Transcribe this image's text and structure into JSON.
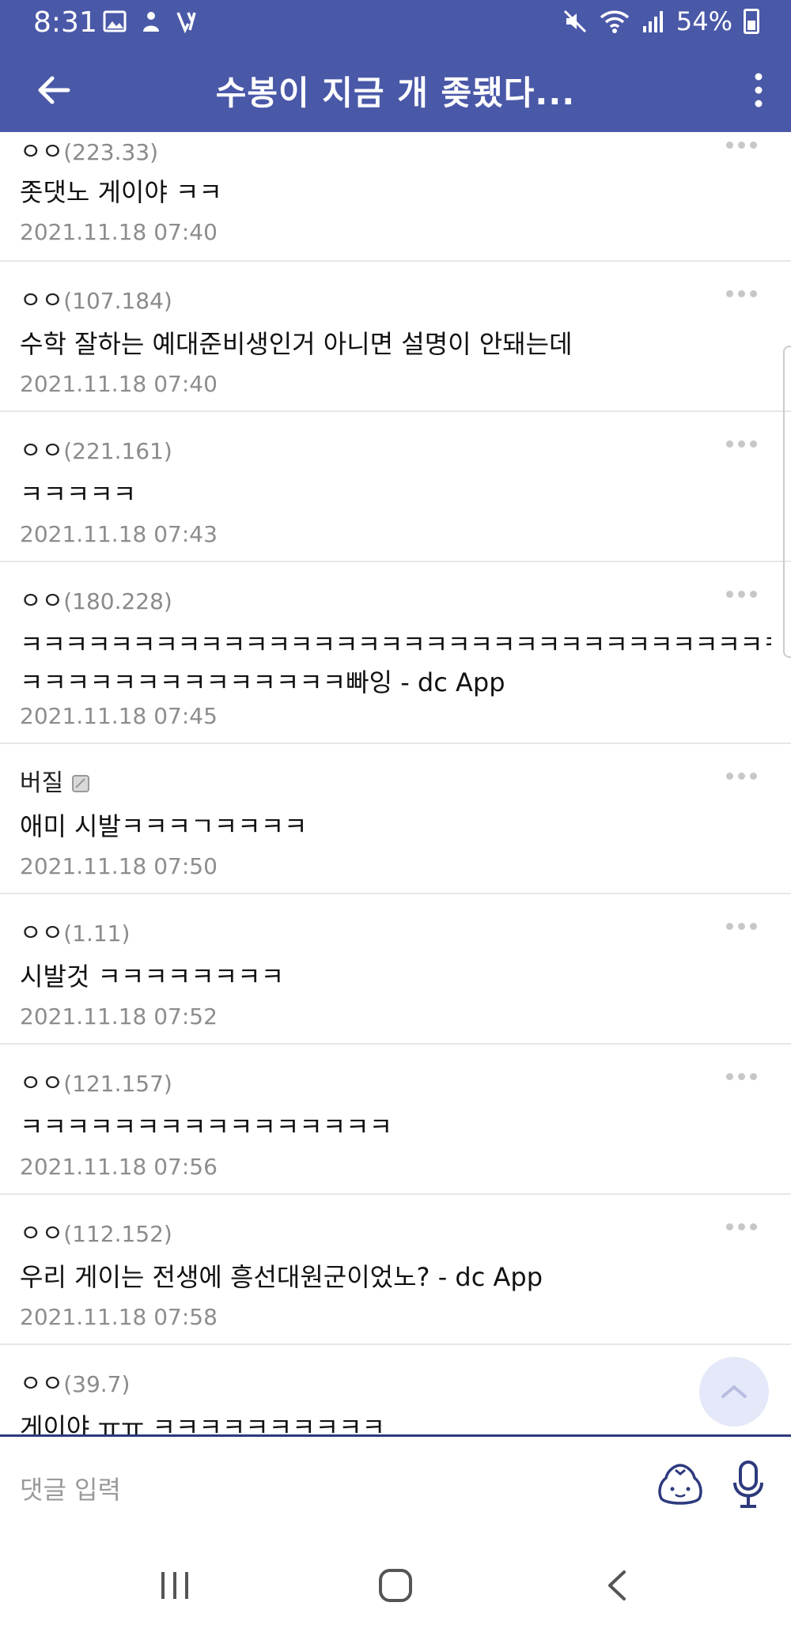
{
  "status_bar": {
    "time": "8:31",
    "battery": "54%",
    "left_icons": [
      "image-icon",
      "tutoring-icon",
      "v-app-icon"
    ],
    "right_icons": [
      "mute-icon",
      "wifi-icon",
      "signal-icon",
      "battery-icon"
    ]
  },
  "app_bar": {
    "title": "수봉이 지금 개 좆됐다...",
    "color": "#4a58a8"
  },
  "comments": [
    {
      "author": "ㅇㅇ",
      "ip": "(223.33)",
      "lines": [
        "좃댓노 게이야 ㅋㅋ"
      ],
      "date": "2021.11.18 07:40"
    },
    {
      "author": "ㅇㅇ",
      "ip": "(107.184)",
      "lines": [
        "수학 잘하는 예대준비생인거 아니면 설명이 안돼는데"
      ],
      "date": "2021.11.18 07:40"
    },
    {
      "author": "ㅇㅇ",
      "ip": "(221.161)",
      "lines": [
        "ㅋㅋㅋㅋㅋ"
      ],
      "date": "2021.11.18 07:43"
    },
    {
      "author": "ㅇㅇ",
      "ip": "(180.228)",
      "lines": [
        "ㅋㅋㅋㅋㅋㅋㅋㅋㅋㅋㅋㅋㅋㅋㅋㅋㅋㅋㅋㅋㅋㅋㅋㅋㅋㅋㅋㅋㅋㅋㅋㅋㅋㅋㅋ",
        "ㅋㅋㅋㅋㅋㅋㅋㅋㅋㅋㅋㅋㅋㅋ빠잉 - dc App"
      ],
      "date": "2021.11.18 07:45"
    },
    {
      "author": "버질",
      "ip": "",
      "lines": [
        "애미 시발ㅋㅋㅋㄱㅋㅋㅋㅋ"
      ],
      "date": "2021.11.18 07:50"
    },
    {
      "author": "ㅇㅇ",
      "ip": "(1.11)",
      "lines": [
        "시발것 ㅋㅋㅋㅋㅋㅋㅋㅋ"
      ],
      "date": "2021.11.18 07:52"
    },
    {
      "author": "ㅇㅇ",
      "ip": "(121.157)",
      "lines": [
        "ㅋㅋㅋㅋㅋㅋㅋㅋㅋㅋㅋㅋㅋㅋㅋㅋ"
      ],
      "date": "2021.11.18 07:56"
    },
    {
      "author": "ㅇㅇ",
      "ip": "(112.152)",
      "lines": [
        "우리 게이는 전생에 흥선대원군이었노? - dc App"
      ],
      "date": "2021.11.18 07:58"
    },
    {
      "author": "ㅇㅇ",
      "ip": "(39.7)",
      "lines": [
        "게이야 ㅠㅠ ㅋㅋㅋㅋㅋㅋㅋㅋㅋㅋ"
      ],
      "date": ""
    }
  ],
  "input": {
    "placeholder": "댓글 입력"
  },
  "nav": {
    "icons": [
      "recent-apps-icon",
      "home-icon",
      "back-icon"
    ]
  }
}
